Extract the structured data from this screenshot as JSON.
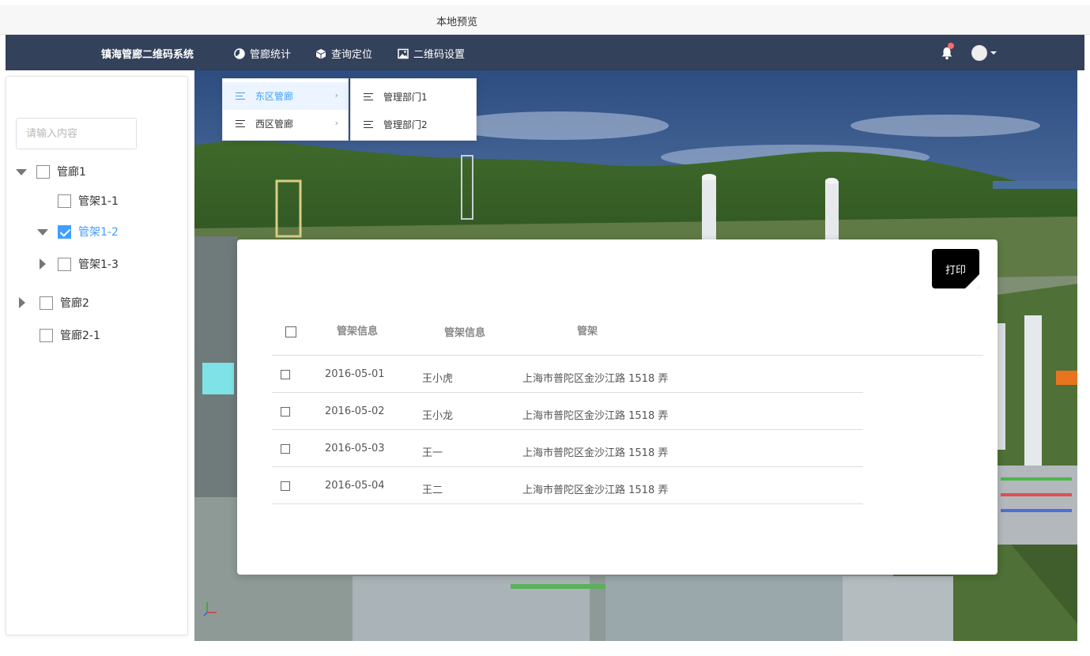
{
  "window": {
    "title": "本地预览"
  },
  "navbar": {
    "brand": "镇海管廊二维码系统",
    "items": [
      {
        "label": "管廊统计",
        "icon": "pie-chart-icon"
      },
      {
        "label": "查询定位",
        "icon": "cube-icon"
      },
      {
        "label": "二维码设置",
        "icon": "picture-icon"
      }
    ],
    "notification_icon": "bell-icon",
    "has_notification": true,
    "avatar_icon": "user-avatar"
  },
  "sidebar": {
    "search": {
      "placeholder": "请输入内容",
      "value": ""
    },
    "tree": [
      {
        "label": "管廊1",
        "expanded": true,
        "checked": false
      },
      {
        "label": "管架1-1",
        "checked": false
      },
      {
        "label": "管架1-2",
        "expanded": true,
        "checked": true
      },
      {
        "label": "管架1-3",
        "expanded": false,
        "checked": false
      },
      {
        "label": "管廊2",
        "expanded": false,
        "checked": false
      },
      {
        "label": "管廊2-1",
        "checked": false
      }
    ]
  },
  "menu": {
    "level1": [
      {
        "label": "东区管廊",
        "active": true
      },
      {
        "label": "西区管廊",
        "active": false
      }
    ],
    "level2": [
      {
        "label": "管理部门1"
      },
      {
        "label": "管理部门2"
      }
    ],
    "submenu_arrow": "›"
  },
  "panel": {
    "print_label": "打印",
    "headers": [
      "管架信息",
      "管架信息",
      "管架"
    ],
    "rows": [
      {
        "date": "2016-05-01",
        "name": "王小虎",
        "address": "上海市普陀区金沙江路 1518 弄"
      },
      {
        "date": "2016-05-02",
        "name": "王小龙",
        "address": "上海市普陀区金沙江路 1518 弄"
      },
      {
        "date": "2016-05-03",
        "name": "王一",
        "address": "上海市普陀区金沙江路 1518 弄"
      },
      {
        "date": "2016-05-04",
        "name": "王二",
        "address": "上海市普陀区金沙江路 1518 弄"
      }
    ]
  },
  "colors": {
    "navbar_bg": "#33415a",
    "accent": "#409eff",
    "badge": "#f56c6c"
  }
}
